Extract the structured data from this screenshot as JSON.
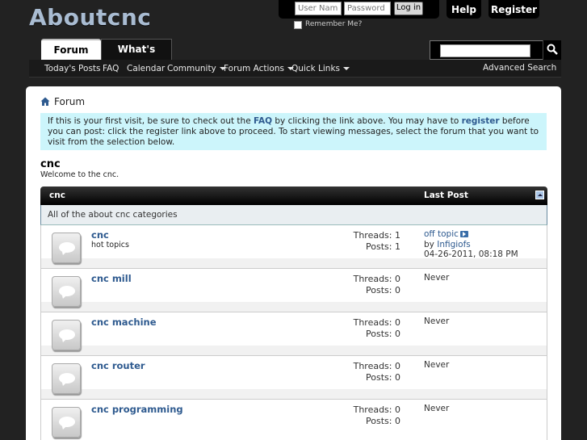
{
  "header": {
    "logo": "Aboutcnc",
    "login": {
      "username_placeholder": "User Name",
      "password_placeholder": "Password",
      "login_button": "Log in",
      "remember": "Remember Me?"
    },
    "help": "Help",
    "register": "Register"
  },
  "nav": {
    "tabs": [
      "Forum",
      "What's New?"
    ],
    "search_icon": "magnifier-icon",
    "subnav": [
      "Today's Posts",
      "FAQ",
      "Calendar",
      "Community",
      "Forum Actions",
      "Quick Links"
    ],
    "advanced_search": "Advanced Search"
  },
  "breadcrumb": {
    "icon": "home-icon",
    "label": "Forum"
  },
  "notice": {
    "p1": "If this is your first visit, be sure to check out the ",
    "faq": "FAQ",
    "p2": " by clicking the link above. You may have to ",
    "register": "register",
    "p3": " before you can post: click the register link above to proceed. To start viewing messages, select the forum that you want to visit from the selection below."
  },
  "category": {
    "title": "cnc",
    "description": "Welcome to the cnc.",
    "header_name": "cnc",
    "header_last": "Last Post",
    "strip": "All of the about cnc categories"
  },
  "forums": [
    {
      "title": "cnc",
      "desc": "hot topics",
      "threads": "Threads: 1",
      "posts": "Posts: 1",
      "last_title": "off topic",
      "last_by": "by ",
      "last_user": "Infigiofs",
      "last_date": "04-26-2011, ",
      "last_time": "08:18 PM"
    },
    {
      "title": "cnc mill",
      "desc": "",
      "threads": "Threads: 0",
      "posts": "Posts: 0",
      "last_title": "Never"
    },
    {
      "title": "cnc machine",
      "desc": "",
      "threads": "Threads: 0",
      "posts": "Posts: 0",
      "last_title": "Never"
    },
    {
      "title": "cnc router",
      "desc": "",
      "threads": "Threads: 0",
      "posts": "Posts: 0",
      "last_title": "Never"
    },
    {
      "title": "cnc programming",
      "desc": "",
      "threads": "Threads: 0",
      "posts": "Posts: 0",
      "last_title": "Never"
    }
  ]
}
